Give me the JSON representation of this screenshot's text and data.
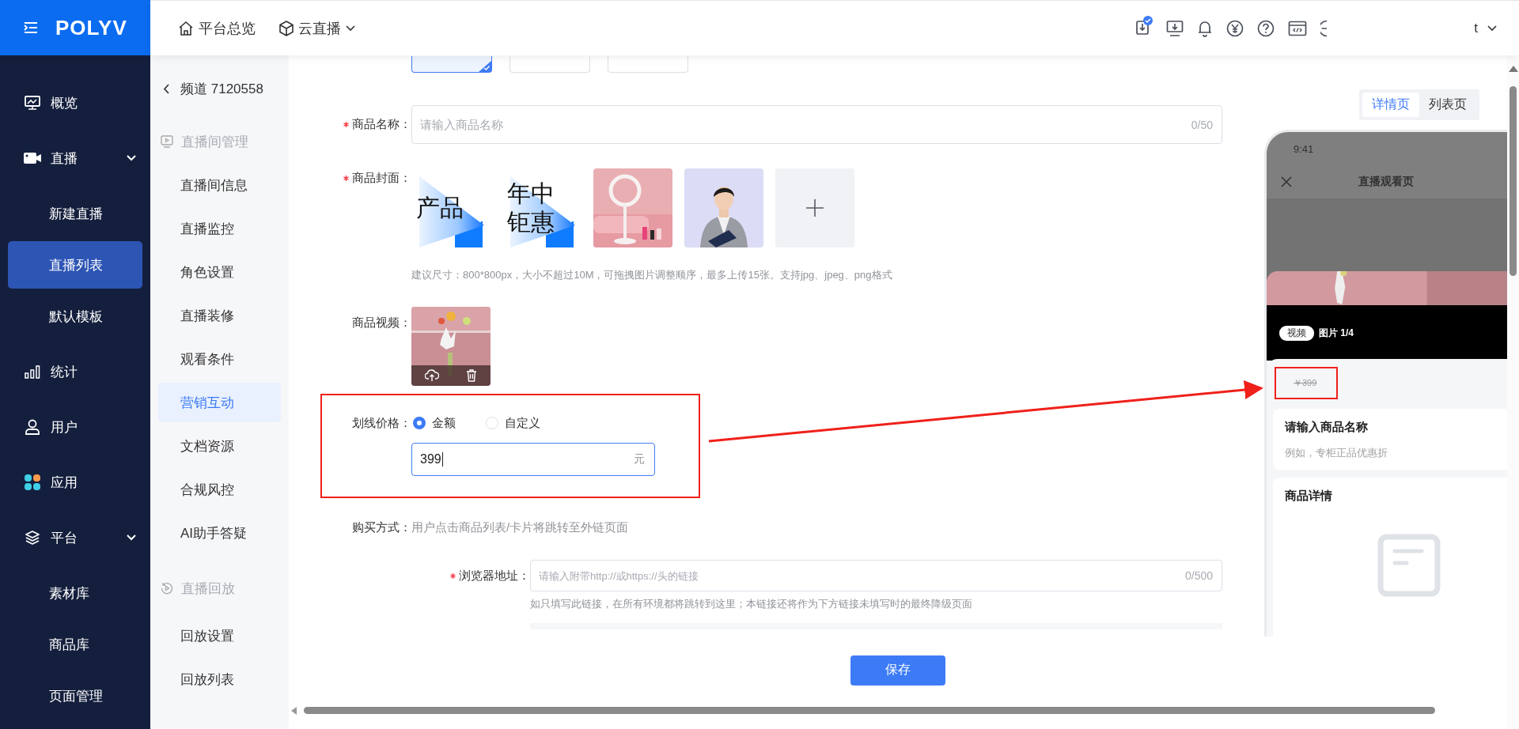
{
  "logo": "POLYV",
  "top_nav": [
    {
      "label": "平台总览",
      "dropdown": false
    },
    {
      "label": "云直播",
      "dropdown": true
    }
  ],
  "user": {
    "name": "t"
  },
  "sidebar": {
    "items": [
      {
        "label": "概览",
        "selected": false
      },
      {
        "label": "直播",
        "selected": false,
        "expanded": true,
        "children": [
          {
            "label": "新建直播",
            "selected": false
          },
          {
            "label": "直播列表",
            "selected": true
          },
          {
            "label": "默认模板",
            "selected": false
          }
        ]
      },
      {
        "label": "统计",
        "selected": false
      },
      {
        "label": "用户",
        "selected": false
      },
      {
        "label": "应用",
        "selected": false
      },
      {
        "label": "平台",
        "selected": false,
        "expanded": true,
        "children": [
          {
            "label": "素材库",
            "selected": false
          },
          {
            "label": "商品库",
            "selected": false
          },
          {
            "label": "页面管理",
            "selected": false
          }
        ]
      }
    ]
  },
  "channel_nav": {
    "back_title": "频道 7120558",
    "sections": [
      {
        "title": "直播间管理",
        "items": [
          {
            "label": "直播间信息",
            "selected": false
          },
          {
            "label": "直播监控",
            "selected": false
          },
          {
            "label": "角色设置",
            "selected": false
          },
          {
            "label": "直播装修",
            "selected": false
          },
          {
            "label": "观看条件",
            "selected": false
          },
          {
            "label": "营销互动",
            "selected": true
          },
          {
            "label": "文档资源",
            "selected": false
          },
          {
            "label": "合规风控",
            "selected": false
          },
          {
            "label": "AI助手答疑",
            "selected": false
          }
        ]
      },
      {
        "title": "直播回放",
        "items": [
          {
            "label": "回放设置",
            "selected": false
          },
          {
            "label": "回放列表",
            "selected": false
          }
        ]
      }
    ]
  },
  "form": {
    "type_options": [
      {
        "selected": true
      },
      {
        "selected": false
      },
      {
        "selected": false
      }
    ],
    "name": {
      "label": "商品名称：",
      "required": true,
      "placeholder": "请输入商品名称",
      "counter": "0/50"
    },
    "cover": {
      "label": "商品封面：",
      "required": true,
      "items": [
        {
          "kind": "graphic",
          "text_lines": [
            "产品"
          ]
        },
        {
          "kind": "graphic",
          "text_lines": [
            "年中",
            "钜惠"
          ]
        },
        {
          "kind": "picture"
        },
        {
          "kind": "picture"
        },
        {
          "kind": "add"
        }
      ],
      "hint": "建议尺寸：800*800px，大小不超过10M，可拖拽图片调整顺序，最多上传15张。支持jpg、jpeg、png格式"
    },
    "video": {
      "label": "商品视频：",
      "required": false
    },
    "strike_price": {
      "label": "划线价格：",
      "highlighted": true,
      "options": [
        {
          "label": "金额",
          "selected": true
        },
        {
          "label": "自定义",
          "selected": false
        }
      ],
      "value": "399",
      "unit": "元",
      "focused": true
    },
    "purchase": {
      "label": "购买方式：",
      "text": "用户点击商品列表/卡片将跳转至外链页面"
    },
    "browser_url": {
      "label": "浏览器地址：",
      "required": true,
      "placeholder": "请输入附带http://或https://头的链接",
      "counter": "0/500",
      "hint": "如只填写此链接，在所有环境都将跳转到这里；本链接还将作为下方链接未填写时的最终降级页面"
    },
    "save": "保存"
  },
  "preview": {
    "tabs": [
      {
        "label": "详情页",
        "selected": true
      },
      {
        "label": "列表页",
        "selected": false
      }
    ],
    "phone": {
      "time": "9:41",
      "title": "直播观看页",
      "media_tags": [
        {
          "label": "视频",
          "selected": true
        },
        {
          "label": "图片 1/4",
          "selected": false
        }
      ],
      "strike_price": "￥399",
      "product_name": "请输入商品名称",
      "product_subtitle": "例如，专柜正品优惠折",
      "details_title": "商品详情"
    }
  }
}
